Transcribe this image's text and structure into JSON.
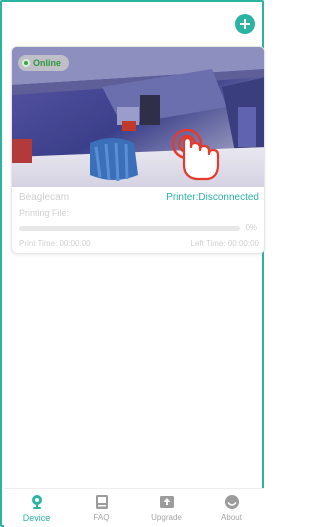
{
  "header": {
    "add_icon": "plus-circle-icon",
    "accent": "#2bb3a3"
  },
  "device_card": {
    "online_label": "Online",
    "printer_name": "Beaglecam",
    "printer_status": "Printer:Disconnected",
    "printing_file_label": "Printing File:",
    "progress": 0,
    "progress_label": "0%",
    "print_time": "Print Time: 00:00:00",
    "left_time": "Left Time: 00:00:00",
    "status_color": "#2bb3a3"
  },
  "tabbar": {
    "tabs": [
      {
        "label": "Device",
        "icon": "webcam-icon",
        "active": true
      },
      {
        "label": "FAQ",
        "icon": "book-icon",
        "active": false
      },
      {
        "label": "Upgrade",
        "icon": "upgrade-icon",
        "active": false
      },
      {
        "label": "About",
        "icon": "smiley-icon",
        "active": false
      }
    ]
  }
}
